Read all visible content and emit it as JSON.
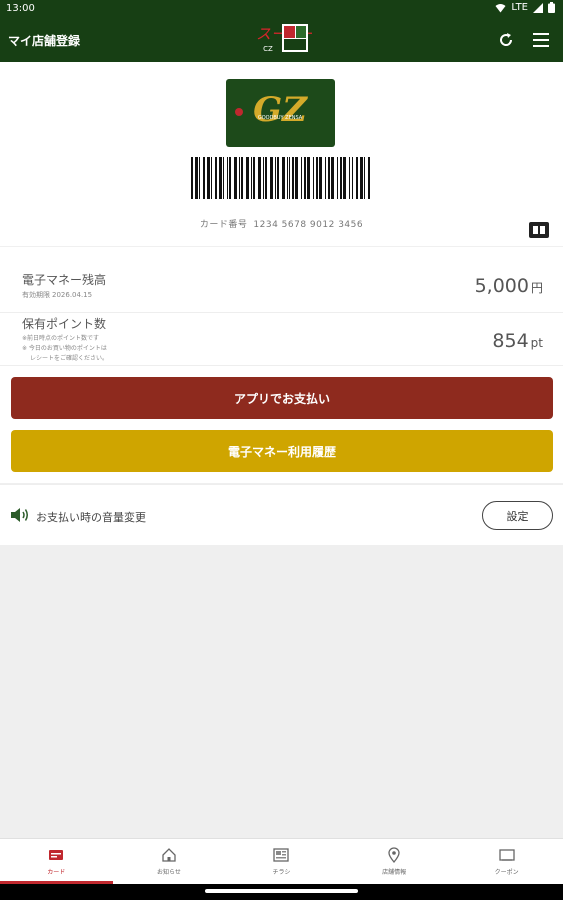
{
  "status_bar": {
    "time": "13:00",
    "network": "LTE"
  },
  "app_bar": {
    "title": "マイ店舗登録",
    "logo_text": "CZ"
  },
  "card": {
    "number_label": "カード番号",
    "number": "1234 5678 9012 3456",
    "logo_letters": "GZ",
    "brand_text": "GOODBUY ZENSA"
  },
  "balance": {
    "label": "電子マネー残高",
    "expiry_label": "有効期限",
    "expiry_date": "2026.04.15",
    "amount": "5,000",
    "unit": "円"
  },
  "points": {
    "label": "保有ポイント数",
    "note1": "※前日時点のポイント数です",
    "note2": "※ 今日のお買い物のポイントは",
    "note3": "レシートをご確認ください。",
    "amount": "854",
    "unit": "pt"
  },
  "buttons": {
    "pay": "アプリでお支払い",
    "history": "電子マネー利用履歴"
  },
  "volume": {
    "label": "お支払い時の音量変更",
    "button": "設定"
  },
  "bottom_nav": [
    {
      "label": "カード",
      "icon": "card-icon",
      "active": true
    },
    {
      "label": "お知らせ",
      "icon": "home-icon",
      "active": false
    },
    {
      "label": "チラシ",
      "icon": "flyer-icon",
      "active": false
    },
    {
      "label": "店舗情報",
      "icon": "map-pin-icon",
      "active": false
    },
    {
      "label": "クーポン",
      "icon": "coupon-icon",
      "active": false
    }
  ],
  "colors": {
    "header_green": "#173f14",
    "pay_red": "#8e2a1e",
    "history_gold": "#cfa500",
    "active_red": "#c0282e"
  }
}
